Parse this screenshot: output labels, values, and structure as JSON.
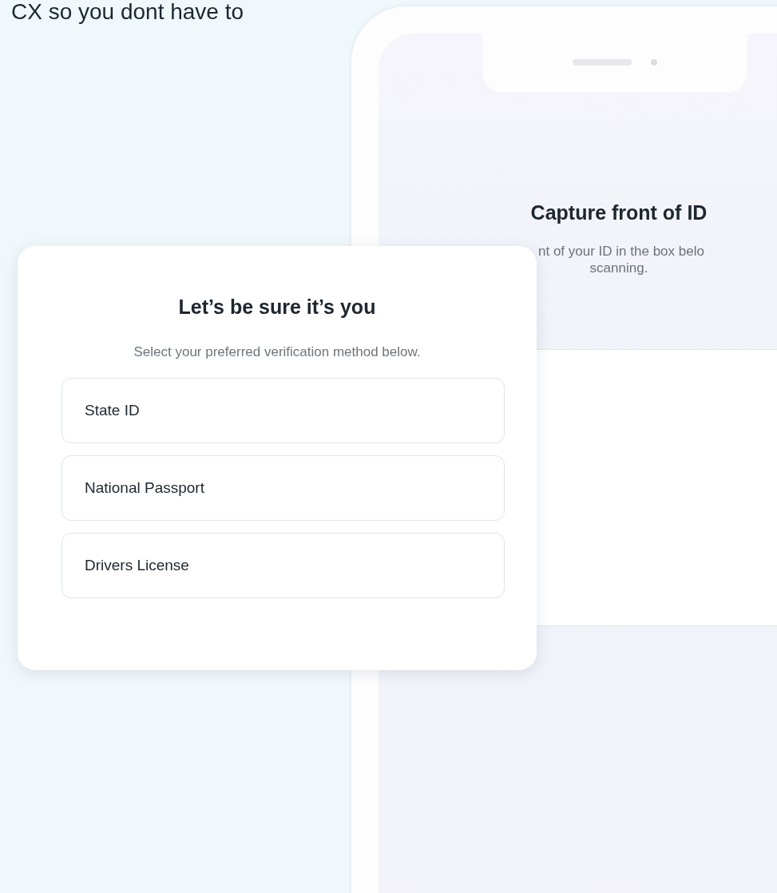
{
  "headline": "CX so you dont have to",
  "phone": {
    "title": "Capture front of ID",
    "subtitle_lines": [
      "nt of your ID in the box belo",
      "scanning."
    ]
  },
  "card": {
    "title": "Let’s be sure it’s you",
    "subtitle": "Select your preferred verification method below.",
    "options": [
      {
        "label": "State ID"
      },
      {
        "label": "National Passport"
      },
      {
        "label": "Drivers License"
      }
    ]
  }
}
